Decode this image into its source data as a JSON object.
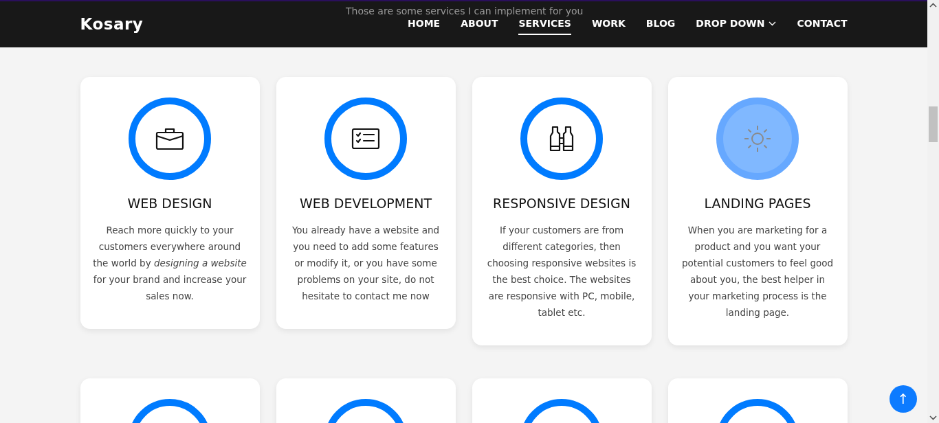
{
  "navbar": {
    "brand": "Kosary",
    "items": [
      {
        "label": "HOME",
        "selected": false,
        "dropdown": false
      },
      {
        "label": "ABOUT",
        "selected": false,
        "dropdown": false
      },
      {
        "label": "SERVICES",
        "selected": true,
        "dropdown": false
      },
      {
        "label": "WORK",
        "selected": false,
        "dropdown": false
      },
      {
        "label": "BLOG",
        "selected": false,
        "dropdown": false
      },
      {
        "label": "DROP DOWN",
        "selected": false,
        "dropdown": true
      },
      {
        "label": "CONTACT",
        "selected": false,
        "dropdown": false
      }
    ]
  },
  "section": {
    "subtitle": "Those are some services I can implement for you"
  },
  "services": [
    {
      "title": "WEB DESIGN",
      "text": "Reach more quickly to your customers everywhere around the world by *designing a website* for your brand and increase your sales now.",
      "hovered": false
    },
    {
      "title": "WEB DEVELOPMENT",
      "text": "You already have a website and you need to add some features or modify it, or you have some problems on your site, do not hesitate to contact me now",
      "hovered": false
    },
    {
      "title": "RESPONSIVE DESIGN",
      "text": "If your customers are from different categories, then choosing responsive websites is the best choice. The websites are responsive with PC, mobile, tablet etc.",
      "hovered": false
    },
    {
      "title": "LANDING PAGES",
      "text": "When you are marketing for a product and you want your potential customers to feel good about you, the best helper in your marketing process is the landing page.",
      "hovered": true
    }
  ],
  "lower_services": [
    {
      "hovered": false
    },
    {
      "hovered": false
    },
    {
      "hovered": false
    },
    {
      "hovered": false
    }
  ],
  "back_to_top": {
    "arrow": "↑"
  }
}
